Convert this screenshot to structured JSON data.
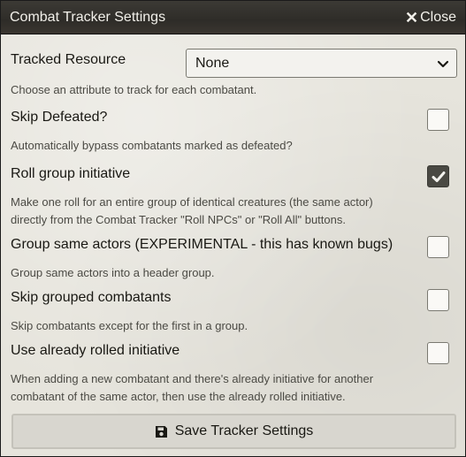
{
  "window": {
    "title": "Combat Tracker Settings",
    "close_label": "Close"
  },
  "settings": {
    "tracked_resource": {
      "label": "Tracked Resource",
      "value": "None",
      "hint": "Choose an attribute to track for each combatant."
    },
    "skip_defeated": {
      "label": "Skip Defeated?",
      "checked": false,
      "hint": "Automatically bypass combatants marked as defeated?"
    },
    "roll_group_initiative": {
      "label": "Roll group initiative",
      "checked": true,
      "hint_line1": "Make one roll for an entire group of identical creatures (the same actor)",
      "hint_line2": "directly from the Combat Tracker \"Roll NPCs\" or \"Roll All\" buttons."
    },
    "group_same_actors": {
      "label": "Group same actors (EXPERIMENTAL - this has known bugs)",
      "checked": false,
      "hint": "Group same actors into a header group."
    },
    "skip_grouped": {
      "label": "Skip grouped combatants",
      "checked": false,
      "hint": "Skip combatants except for the first in a group."
    },
    "use_rolled_initiative": {
      "label": "Use already rolled initiative",
      "checked": false,
      "hint_line1": "When adding a new combatant and there's already initiative for another",
      "hint_line2": "combatant of the same actor, then use the already rolled initiative."
    }
  },
  "save_button": {
    "label": "Save Tracker Settings",
    "icon": "save-icon"
  },
  "colors": {
    "titlebar": "#2e2c28",
    "panel": "#e6e4dc",
    "checked_box": "#4a4943"
  }
}
